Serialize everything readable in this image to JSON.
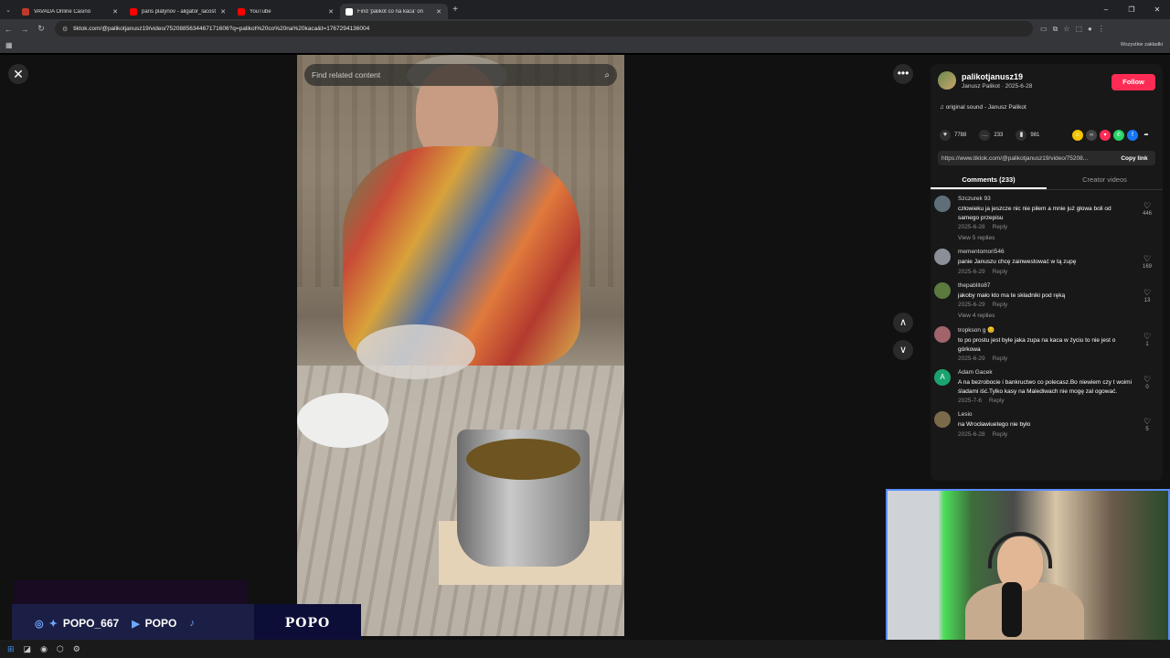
{
  "browser": {
    "tabs": [
      {
        "title": "VAVADA Online Casino",
        "color": "#c0392b"
      },
      {
        "title": "paris platynov - aligator_lacost",
        "color": "#ff0000"
      },
      {
        "title": "YouTube",
        "color": "#ff0000"
      },
      {
        "title": "Find 'palikot co na kaca' on",
        "color": "#ffffff",
        "active": true
      }
    ],
    "url": "tiktok.com/@palikotjanusz19/video/7520885634467171606?q=palikot%20co%20na%20kaca&t=1767294136004",
    "bookmarks_all": "Wszystkie zakładki"
  },
  "search": {
    "placeholder": "Find related content"
  },
  "post": {
    "username": "palikotjanusz19",
    "subtitle": "Janusz Palikot · 2025-6-28",
    "follow_label": "Follow",
    "sound": "original sound - Janusz Palikot",
    "likes": "7788",
    "comments": "233",
    "saves": "981",
    "link": "https://www.tiktok.com/@palikotjanusz19/video/75208...",
    "copy_label": "Copy link",
    "tab_comments": "Comments (233)",
    "tab_creator": "Creator videos"
  },
  "comments": [
    {
      "user": "Szczurek 93",
      "text": "człowieku ja jeszcze nic nie piłem a mnie już głowa boli od samego przepisu",
      "date": "2025-6-28",
      "reply": "Reply",
      "likes": "446",
      "views": "View 5 replies",
      "avatar": "#5f6f7a"
    },
    {
      "user": "mementomori546",
      "text": "panie Januszu chcę zainwestować w tą zupę",
      "date": "2025-6-29",
      "reply": "Reply",
      "likes": "169",
      "views": "",
      "avatar": "#8a8f98"
    },
    {
      "user": "thepablito87",
      "text": "jakoby mało kto ma te składniki pod ręką",
      "date": "2025-6-29",
      "reply": "Reply",
      "likes": "13",
      "views": "View 4 replies",
      "avatar": "#5b7a3e"
    },
    {
      "user": "tropkson g 😊",
      "text": "to po prostu jest byle jaka zupa na kaca w życiu to nie jest o górkowa",
      "date": "2025-6-29",
      "reply": "Reply",
      "likes": "1",
      "views": "",
      "avatar": "#a0646a"
    },
    {
      "user": "Adam Gacek",
      "text": "A na bezrobocie i bankructwo co polecasz.Bo niewiem czy t woimi śladami iść.Tylko kasy na Malediwach nie mogę zal ogować.",
      "date": "2025-7-6",
      "reply": "Reply",
      "likes": "0",
      "views": "",
      "avatar": "#1aa36f",
      "initial": "A"
    },
    {
      "user": "Lesio",
      "text": "na Wrocławiuetego nie było",
      "date": "2025-6-28",
      "reply": "Reply",
      "likes": "5",
      "views": "",
      "avatar": "#7a6a4a"
    }
  ],
  "overlay": {
    "handle1": "POPO_667",
    "handle2": "POPO",
    "brand": "POPO"
  }
}
